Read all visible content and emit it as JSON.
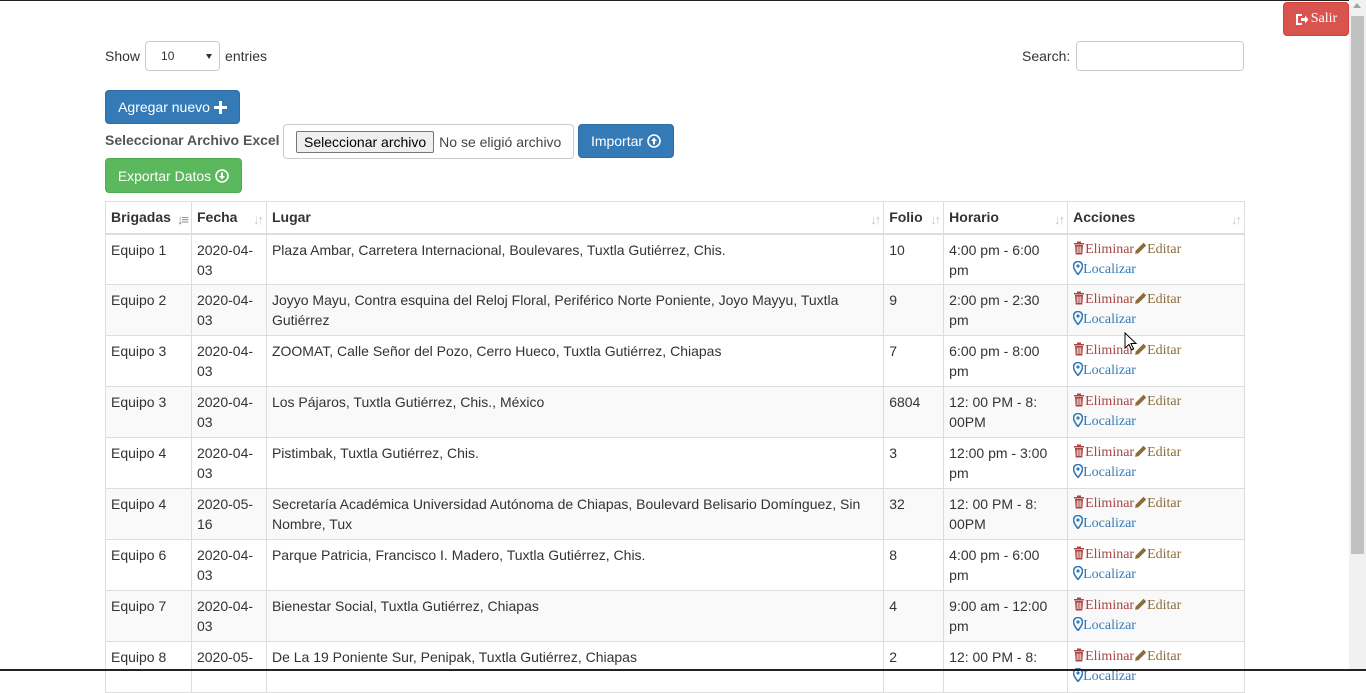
{
  "header": {
    "logout_label": "Salir",
    "logout_icon": "sign-out-icon"
  },
  "length": {
    "show_label": "Show",
    "value": "10",
    "entries_label": "entries"
  },
  "search": {
    "label": "Search:",
    "value": ""
  },
  "actions_bar": {
    "add_label": "Agregar nuevo",
    "excel_label": "Seleccionar Archivo Excel",
    "file_button": "Seleccionar archivo",
    "file_status": "No se eligió archivo",
    "import_label": "Importar",
    "export_label": "Exportar Datos"
  },
  "table": {
    "columns": [
      "Brigadas",
      "Fecha",
      "Lugar",
      "Folio",
      "Horario",
      "Acciones"
    ],
    "row_actions": {
      "delete": "Eliminar",
      "edit": "Editar",
      "locate": "Localizar"
    },
    "rows": [
      {
        "brigada": "Equipo 1",
        "fecha": "2020-04-03",
        "lugar": "Plaza Ambar, Carretera Internacional, Boulevares, Tuxtla Gutiérrez, Chis.",
        "folio": "10",
        "horario": "4:00 pm - 6:00 pm"
      },
      {
        "brigada": "Equipo 2",
        "fecha": "2020-04-03",
        "lugar": "Joyyo Mayu, Contra esquina del Reloj Floral, Periférico Norte Poniente, Joyo Mayyu, Tuxtla Gutiérrez",
        "folio": "9",
        "horario": "2:00 pm - 2:30 pm"
      },
      {
        "brigada": "Equipo 3",
        "fecha": "2020-04-03",
        "lugar": "ZOOMAT, Calle Señor del Pozo, Cerro Hueco, Tuxtla Gutiérrez, Chiapas",
        "folio": "7",
        "horario": "6:00 pm - 8:00 pm"
      },
      {
        "brigada": "Equipo 3",
        "fecha": "2020-04-03",
        "lugar": "Los Pájaros, Tuxtla Gutiérrez, Chis., México",
        "folio": "6804",
        "horario": "12: 00 PM - 8: 00PM"
      },
      {
        "brigada": "Equipo 4",
        "fecha": "2020-04-03",
        "lugar": "Pistimbak, Tuxtla Gutiérrez, Chis.",
        "folio": "3",
        "horario": "12:00 pm - 3:00 pm"
      },
      {
        "brigada": "Equipo 4",
        "fecha": "2020-05-16",
        "lugar": "Secretaría Académica Universidad Autónoma de Chiapas, Boulevard Belisario Domínguez, Sin Nombre, Tux",
        "folio": "32",
        "horario": "12: 00 PM - 8: 00PM"
      },
      {
        "brigada": "Equipo 6",
        "fecha": "2020-04-03",
        "lugar": "Parque Patricia, Francisco I. Madero, Tuxtla Gutiérrez, Chis.",
        "folio": "8",
        "horario": "4:00 pm - 6:00 pm"
      },
      {
        "brigada": "Equipo 7",
        "fecha": "2020-04-03",
        "lugar": "Bienestar Social, Tuxtla Gutiérrez, Chiapas",
        "folio": "4",
        "horario": "9:00 am - 12:00 pm"
      },
      {
        "brigada": "Equipo 8",
        "fecha": "2020-05-",
        "lugar": "De La 19 Poniente Sur, Penipak, Tuxtla Gutiérrez, Chiapas",
        "folio": "2",
        "horario": "12: 00 PM - 8:"
      }
    ]
  },
  "colors": {
    "primary": "#337ab7",
    "success": "#5cb85c",
    "danger": "#d9534f",
    "delete": "#a94442",
    "edit": "#8a6d3b"
  }
}
